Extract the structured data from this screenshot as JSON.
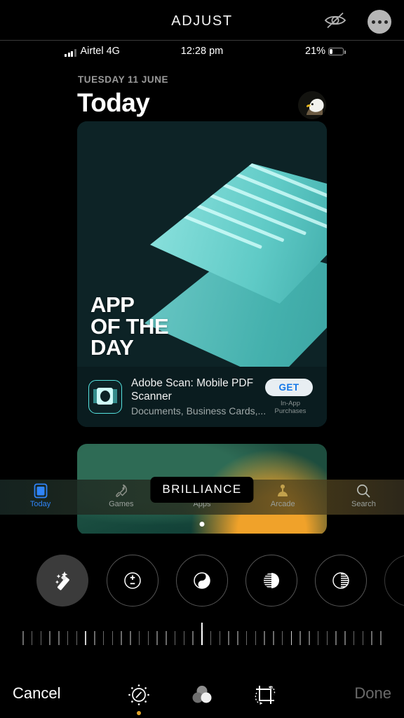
{
  "header": {
    "title": "ADJUST",
    "hide_icon": "eye-slash-icon",
    "more_icon": "ellipsis-icon"
  },
  "status_bar": {
    "carrier": "Airtel 4G",
    "time": "12:28 pm",
    "battery_percent": "21%",
    "signal_icon": "cellular-signal-icon",
    "battery_icon": "battery-icon"
  },
  "today_screen": {
    "date": "TUESDAY 11 JUNE",
    "title": "Today",
    "avatar": "eagle-profile-avatar"
  },
  "feature_card": {
    "headline": "APP\nOF THE\nDAY",
    "headline_lines": [
      "APP",
      "OF THE",
      "DAY"
    ],
    "app_name": "Adobe Scan: Mobile PDF Scanner",
    "app_subtitle": "Documents, Business Cards,...",
    "get_label": "GET",
    "iap_label": "In-App Purchases",
    "app_icon": "adobe-scan-app-icon",
    "art_colors": [
      "#0d2326",
      "#8fe3df",
      "#49bdb9",
      "#2f9c9b"
    ]
  },
  "tab_bar": {
    "tabs": [
      {
        "label": "Today",
        "icon": "today-icon",
        "active": true
      },
      {
        "label": "Games",
        "icon": "rocket-icon",
        "active": false
      },
      {
        "label": "Apps",
        "icon": "apps-icon",
        "active": false
      },
      {
        "label": "Arcade",
        "icon": "arcade-joystick-icon",
        "active": false
      },
      {
        "label": "Search",
        "icon": "search-icon",
        "active": false
      }
    ]
  },
  "tooltip": {
    "label": "BRILLIANCE"
  },
  "adjust_tools": [
    {
      "name": "auto-enhance",
      "icon": "magic-wand-icon",
      "selected": true,
      "style": "filled"
    },
    {
      "name": "exposure",
      "icon": "exposure-icon",
      "selected": false,
      "style": "outline"
    },
    {
      "name": "brilliance",
      "icon": "brilliance-icon",
      "selected": false,
      "style": "outline"
    },
    {
      "name": "highlights",
      "icon": "highlights-icon",
      "selected": false,
      "style": "outline"
    },
    {
      "name": "shadows",
      "icon": "shadows-icon",
      "selected": false,
      "style": "outline"
    },
    {
      "name": "contrast",
      "icon": "contrast-icon",
      "selected": false,
      "style": "outline"
    }
  ],
  "slider": {
    "value_position_percent": 50,
    "tick_count": 41
  },
  "bottom_bar": {
    "cancel_label": "Cancel",
    "done_label": "Done",
    "tools": [
      {
        "name": "adjust",
        "icon": "adjust-dial-icon",
        "active": true
      },
      {
        "name": "filters",
        "icon": "filters-circles-icon",
        "active": false
      },
      {
        "name": "crop",
        "icon": "crop-rotate-icon",
        "active": false
      }
    ]
  },
  "colors": {
    "background": "#000000",
    "accent_blue": "#2f84f7",
    "accent_amber": "#e0a32a",
    "get_blue": "#1578e8",
    "muted_text": "#6a6a6a"
  }
}
